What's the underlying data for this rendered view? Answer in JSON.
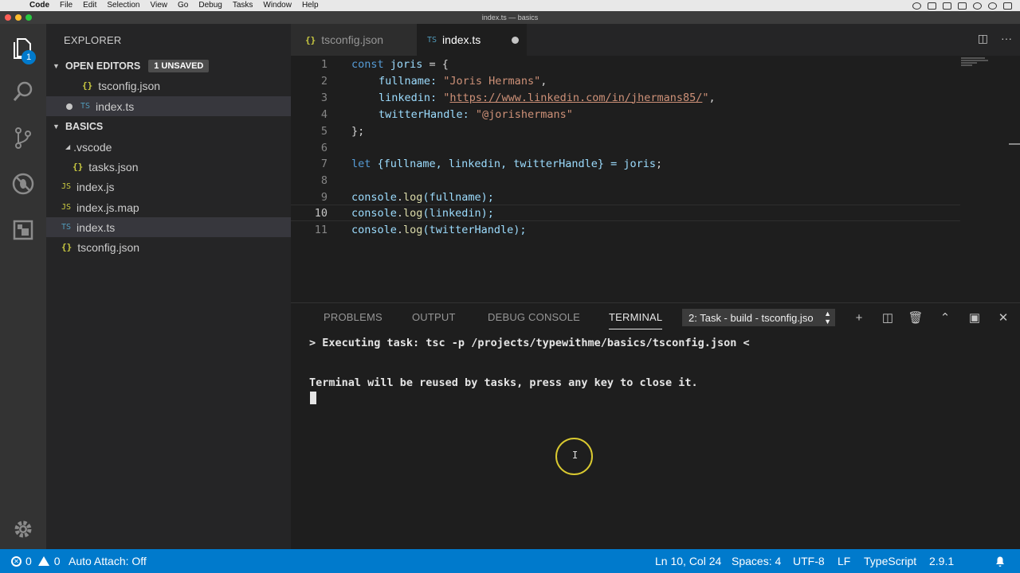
{
  "menubar": {
    "app": "Code",
    "items": [
      "File",
      "Edit",
      "Selection",
      "View",
      "Go",
      "Debug",
      "Tasks",
      "Window",
      "Help"
    ]
  },
  "window": {
    "title": "index.ts — basics"
  },
  "activity": {
    "explorer_badge": "1"
  },
  "sidebar": {
    "title": "EXPLORER",
    "open_editors": {
      "label": "OPEN EDITORS",
      "badge": "1 UNSAVED",
      "files": [
        "tsconfig.json",
        "index.ts"
      ]
    },
    "folder": {
      "label": "BASICS",
      "subfolder": ".vscode",
      "subfolder_file": "tasks.json",
      "files": [
        "index.js",
        "index.js.map",
        "index.ts",
        "tsconfig.json"
      ]
    }
  },
  "tabs": [
    {
      "label": "tsconfig.json",
      "active": false
    },
    {
      "label": "index.ts",
      "active": true,
      "modified": true
    }
  ],
  "editor": {
    "line_numbers": [
      "1",
      "2",
      "3",
      "4",
      "5",
      "6",
      "7",
      "8",
      "9",
      "10",
      "11"
    ],
    "current_line": "10",
    "tokens": {
      "const": "const",
      "joris": "joris",
      "eq_brace": " = {",
      "fullname_key": "fullname: ",
      "fullname_val": "\"Joris Hermans\"",
      "comma": ",",
      "linkedin_key": "linkedin: ",
      "quote": "\"",
      "linkedin_url": "https://www.linkedin.com/in/jhermans85/",
      "twitter_key": "twitterHandle: ",
      "twitter_val": "\"@jorishermans\"",
      "close_obj": "};",
      "let": "let",
      "destructure": " {fullname, linkedin, twitterHandle} = ",
      "semi": ";",
      "console": "console",
      "log": "log",
      "dot": ".",
      "arg_fullname": "(fullname);",
      "arg_linkedin": "(linkedin);",
      "arg_twitter": "(twitterHandle);"
    }
  },
  "panel": {
    "tabs": [
      "PROBLEMS",
      "OUTPUT",
      "DEBUG CONSOLE",
      "TERMINAL"
    ],
    "active_tab": "TERMINAL",
    "task_select": "2: Task - build - tsconfig.jso",
    "terminal_lines": [
      "> Executing task: tsc -p /projects/typewithme/basics/tsconfig.json <",
      "Terminal will be reused by tasks, press any key to close it."
    ]
  },
  "status": {
    "errors": "0",
    "warnings": "0",
    "auto_attach": "Auto Attach: Off",
    "position": "Ln 10, Col 24",
    "spaces": "Spaces: 4",
    "encoding": "UTF-8",
    "eol": "LF",
    "language": "TypeScript",
    "version": "2.9.1"
  },
  "colors": {
    "accent": "#007acc",
    "sidebar": "#252526",
    "editor": "#1e1e1e"
  }
}
